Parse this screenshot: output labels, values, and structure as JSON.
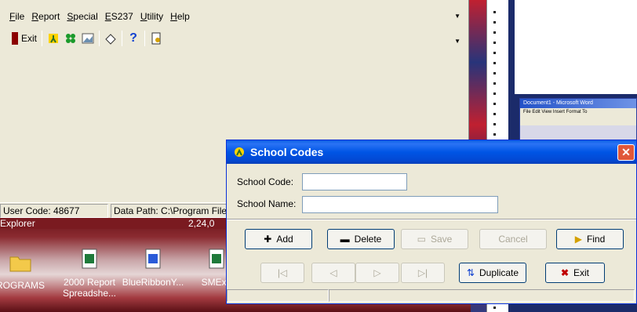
{
  "app": {
    "menu": [
      {
        "label": "File",
        "u": "F"
      },
      {
        "label": "Report",
        "u": "R"
      },
      {
        "label": "Special",
        "u": "S"
      },
      {
        "label": "ES237",
        "u": "E"
      },
      {
        "label": "Utility",
        "u": "U"
      },
      {
        "label": "Help",
        "u": "H"
      }
    ],
    "toolbar": {
      "exit_label": "Exit"
    },
    "status": {
      "user_code": "User Code:  48677",
      "data_path": "Data Path:  C:\\Program File"
    }
  },
  "desktop": {
    "explorer_label": "Explorer",
    "clock": "2,24,0",
    "icons": [
      {
        "label": "ROGRAMS"
      },
      {
        "label": "2000 Report Spreadshe..."
      },
      {
        "label": "BlueRibbonY..."
      },
      {
        "label": "SMExp"
      }
    ]
  },
  "word": {
    "title": "Document1 - Microsoft Word",
    "menu": "File  Edit  View  Insert  Format  To"
  },
  "dialog": {
    "title": "School Codes",
    "school_code_label": "School Code:",
    "school_code_value": "",
    "school_name_label": "School Name:",
    "school_name_value": "",
    "buttons": {
      "add": "Add",
      "delete": "Delete",
      "save": "Save",
      "cancel": "Cancel",
      "find": "Find",
      "duplicate": "Duplicate",
      "exit": "Exit"
    },
    "nav": {
      "first": "|◁",
      "prev": "◁",
      "next": "▷",
      "last": "▷|"
    },
    "close": "✕"
  },
  "colors": {
    "titlebar": "#0055e5",
    "window_bg": "#ece9d8",
    "close_button": "#e0583a"
  }
}
